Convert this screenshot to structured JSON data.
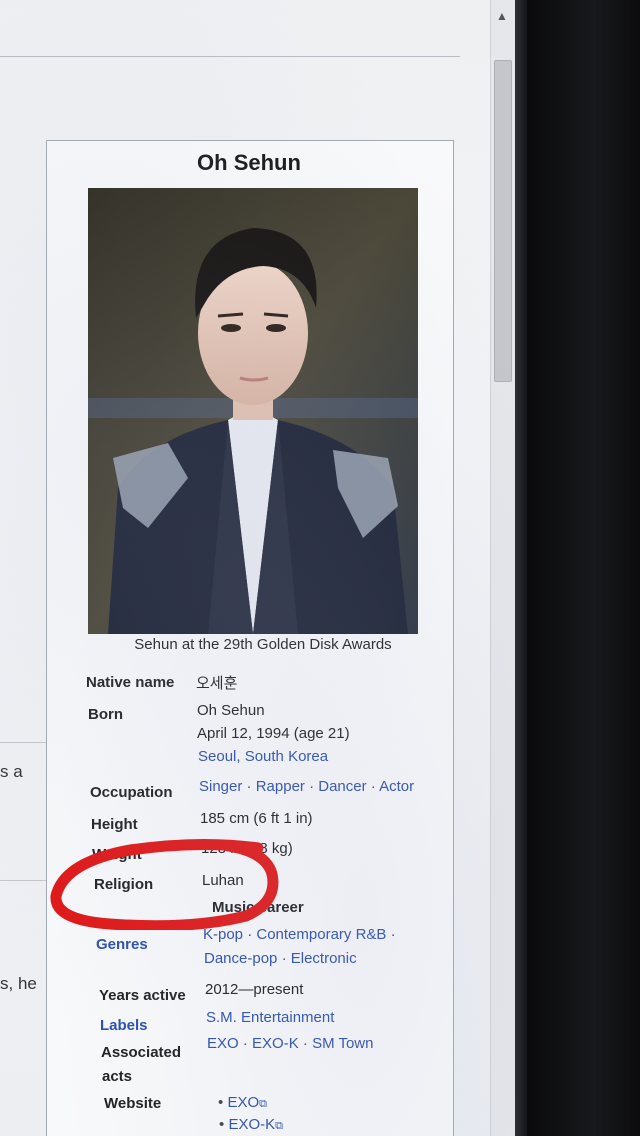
{
  "page": {
    "left_snippets": [
      "s a",
      "s, he"
    ]
  },
  "infobox": {
    "title": "Oh Sehun",
    "caption": "Sehun at the 29th Golden Disk Awards",
    "native_name": {
      "label": "Native name",
      "value": "오세훈"
    },
    "born": {
      "label": "Born",
      "name": "Oh Sehun",
      "date": "April 12, 1994 (age 21)",
      "place": "Seoul, South Korea"
    },
    "occupation": {
      "label": "Occupation",
      "items": [
        "Singer",
        "Rapper",
        "Dancer",
        "Actor"
      ]
    },
    "height": {
      "label": "Height",
      "value": "185 cm (6 ft 1 in)"
    },
    "weight": {
      "label": "Weight",
      "value": "128 lb (58 kg)"
    },
    "religion": {
      "label": "Religion",
      "value": "Luhan"
    },
    "music_career_header": "Music career",
    "genres": {
      "label": "Genres",
      "line1": [
        "K-pop",
        "Contemporary R&B"
      ],
      "line2": [
        "Dance-pop",
        "Electronic"
      ]
    },
    "years_active": {
      "label": "Years active",
      "value": "2012—present"
    },
    "labels": {
      "label": "Labels",
      "value": "S.M. Entertainment"
    },
    "associated_acts": {
      "label_line1": "Associated",
      "label_line2": "acts",
      "items": [
        "EXO",
        "EXO-K",
        "SM Town"
      ]
    },
    "website": {
      "label": "Website",
      "items": [
        "EXO",
        "EXO-K"
      ]
    }
  },
  "colors": {
    "link": "#2a4fb0",
    "annotation": "#e01616"
  }
}
